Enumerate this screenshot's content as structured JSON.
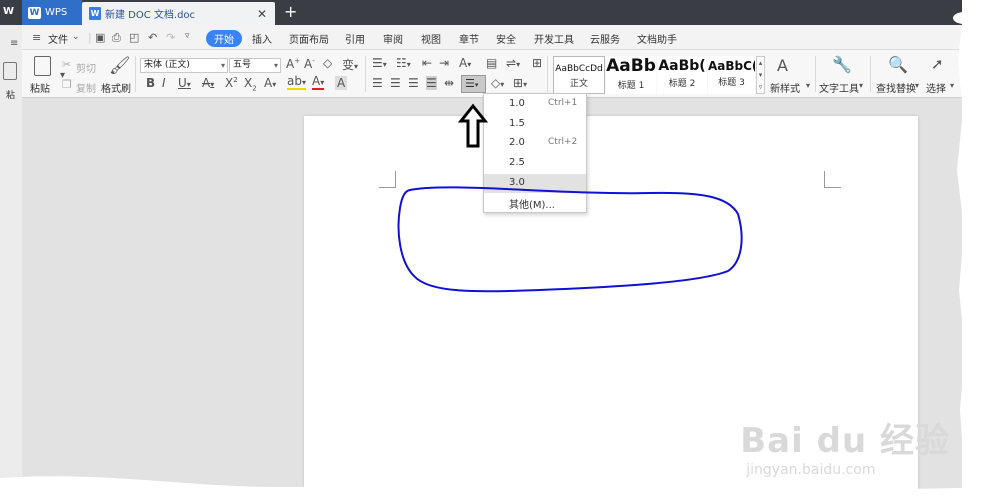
{
  "titlebar": {
    "app_tab": "WPS",
    "doc_tab": "新建 DOC 文档.doc",
    "close_glyph": "✕",
    "new_tab_glyph": "+"
  },
  "menubar": {
    "file_menu": "文件",
    "items": [
      "开始",
      "插入",
      "页面布局",
      "引用",
      "审阅",
      "视图",
      "章节",
      "安全",
      "开发工具",
      "云服务",
      "文档助手"
    ]
  },
  "ribbon": {
    "paste": "粘贴",
    "cut": "剪切",
    "copy": "复制",
    "format_painter": "格式刷",
    "font_name": "宋体 (正文)",
    "font_size": "五号",
    "styles": [
      {
        "sample": "AaBbCcDd",
        "name": "正文"
      },
      {
        "sample": "AaBb",
        "name": "标题 1"
      },
      {
        "sample": "AaBb(",
        "name": "标题 2"
      },
      {
        "sample": "AaBbC(",
        "name": "标题 3"
      }
    ],
    "new_style": "新样式",
    "text_tools": "文字工具",
    "find_replace": "查找替换",
    "select": "选择",
    "edge_paste": "粘"
  },
  "line_spacing_menu": {
    "options": [
      {
        "value": "1.0",
        "shortcut": "Ctrl+1"
      },
      {
        "value": "1.5",
        "shortcut": ""
      },
      {
        "value": "2.0",
        "shortcut": "Ctrl+2"
      },
      {
        "value": "2.5",
        "shortcut": ""
      },
      {
        "value": "3.0",
        "shortcut": ""
      }
    ],
    "selected": "3.0",
    "other": "其他(M)..."
  },
  "watermark": {
    "brand": "Bai du 经验",
    "url": "jingyan.baidu.com"
  },
  "colors": {
    "accent": "#3a82f7",
    "titlebar": "#3b3d45",
    "annotation_circle": "#1010d8"
  }
}
